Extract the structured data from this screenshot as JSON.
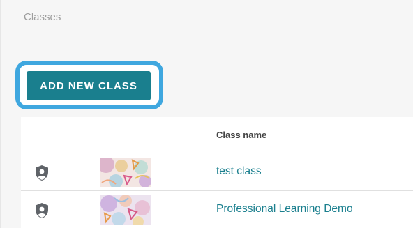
{
  "header": {
    "breadcrumb": "Classes"
  },
  "actions": {
    "add_class_label": "ADD NEW CLASS"
  },
  "table": {
    "columns": [
      "",
      "",
      "Class name"
    ],
    "rows": [
      {
        "icon": "shield-person-icon",
        "name": "test class"
      },
      {
        "icon": "shield-person-icon",
        "name": "Professional Learning Demo"
      }
    ]
  },
  "colors": {
    "accent": "#1a7f8e",
    "highlight_ring": "#3fa7df",
    "background": "#f6f6f6"
  }
}
